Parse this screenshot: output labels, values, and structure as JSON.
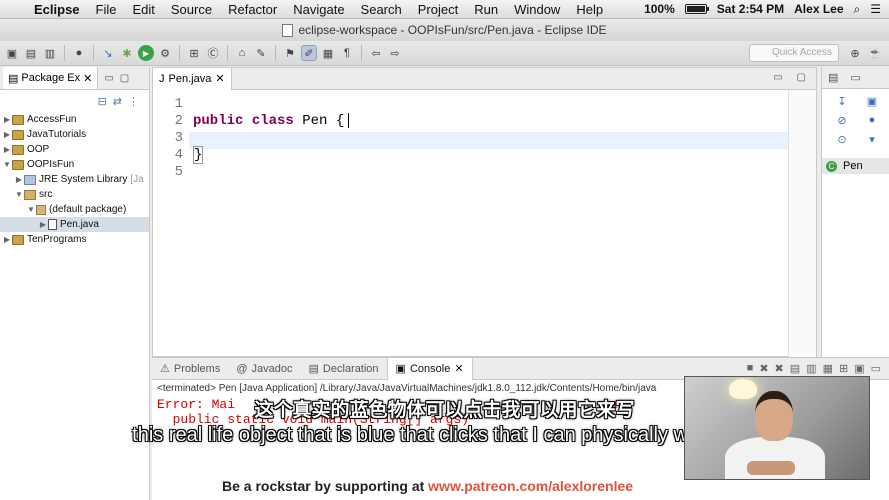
{
  "menubar": {
    "app": "Eclipse",
    "items": [
      "File",
      "Edit",
      "Source",
      "Refactor",
      "Navigate",
      "Search",
      "Project",
      "Run",
      "Window",
      "Help"
    ],
    "battery": "100%",
    "battery_level": 1.0,
    "clock": "Sat 2:54 PM",
    "user": "Alex Lee"
  },
  "window": {
    "title": "eclipse-workspace - OOPIsFun/src/Pen.java - Eclipse IDE"
  },
  "toolbar": {
    "quick_access_placeholder": "Quick Access"
  },
  "package_explorer": {
    "tab_label": "Package Ex",
    "tree": [
      {
        "label": "AccessFun",
        "arrow": "▶",
        "icon": "project"
      },
      {
        "label": "JavaTutorials",
        "arrow": "▶",
        "icon": "project"
      },
      {
        "label": "OOP",
        "arrow": "▶",
        "icon": "project"
      },
      {
        "label": "OOPIsFun",
        "arrow": "▼",
        "icon": "project"
      },
      {
        "label": "JRE System Library",
        "suffix": "[Ja",
        "arrow": "▶",
        "icon": "library"
      },
      {
        "label": "src",
        "arrow": "▼",
        "icon": "source-folder"
      },
      {
        "label": "(default package)",
        "arrow": "▼",
        "icon": "package"
      },
      {
        "label": "Pen.java",
        "arrow": "▶",
        "icon": "java-file",
        "selected": true
      },
      {
        "label": "TenPrograms",
        "arrow": "▶",
        "icon": "project"
      }
    ]
  },
  "editor": {
    "tab_label": "Pen.java",
    "line_numbers": [
      "1",
      "2",
      "3",
      "4",
      "5"
    ],
    "lines": [
      {
        "text": ""
      },
      {
        "kw1": "public",
        "kw2": "class",
        "rest": "Pen {"
      },
      {
        "text": ""
      },
      {
        "text": "}"
      },
      {
        "text": ""
      }
    ]
  },
  "outline": {
    "item_label": "Pen"
  },
  "console": {
    "tabs": [
      "Problems",
      "Javadoc",
      "Declaration",
      "Console"
    ],
    "active_tab": "Console",
    "terminated": "<terminated> Pen [Java Application] /Library/Java/JavaVirtualMachines/jdk1.8.0_112.jdk/Contents/Home/bin/java",
    "error_line1": "Error: Mai                                            ne ma",
    "error_line2": "  public static void main(String[] args)"
  },
  "overlay": {
    "subtitle_cn": "这个真实的蓝色物体可以点击我可以用它来写",
    "subtitle_en": "this real life object that is blue that clicks that I can physically write with",
    "patreon_text": "Be a rockstar by supporting at",
    "patreon_url": "www.patreon.com/alexlorenlee"
  }
}
